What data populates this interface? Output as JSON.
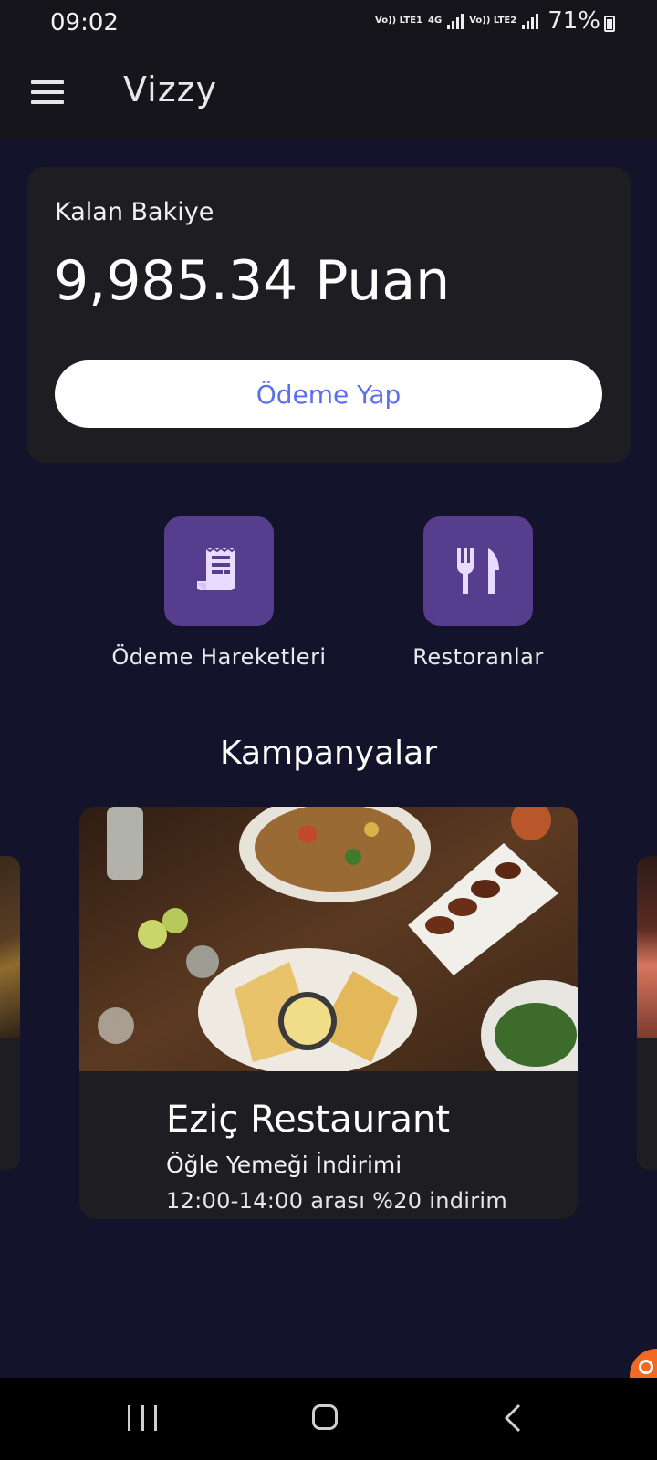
{
  "status_bar": {
    "time": "09:02",
    "sim1": "Vo)) LTE1",
    "network": "4G",
    "sim2": "Vo)) LTE2",
    "battery": "71%"
  },
  "app_bar": {
    "title": "Vizzy",
    "menu_icon": "hamburger-menu-icon"
  },
  "balance": {
    "label": "Kalan Bakiye",
    "value": "9,985.34 Puan",
    "pay_button": "Ödeme Yap"
  },
  "actions": [
    {
      "label": "Ödeme Hareketleri",
      "icon": "receipt-icon"
    },
    {
      "label": "Restoranlar",
      "icon": "fork-knife-icon"
    }
  ],
  "campaigns": {
    "section_title": "Kampanyalar",
    "cards": [
      {
        "title": "Eziç Restaurant",
        "subtitle": "Öğle Yemeği İndirimi",
        "description": "12:00-14:00 arası %20 indirim"
      }
    ]
  },
  "colors": {
    "background": "#13142b",
    "card": "#1e1d22",
    "accent_purple": "#573d8e",
    "button_text": "#5b6ef0",
    "fab": "#f26a21"
  }
}
